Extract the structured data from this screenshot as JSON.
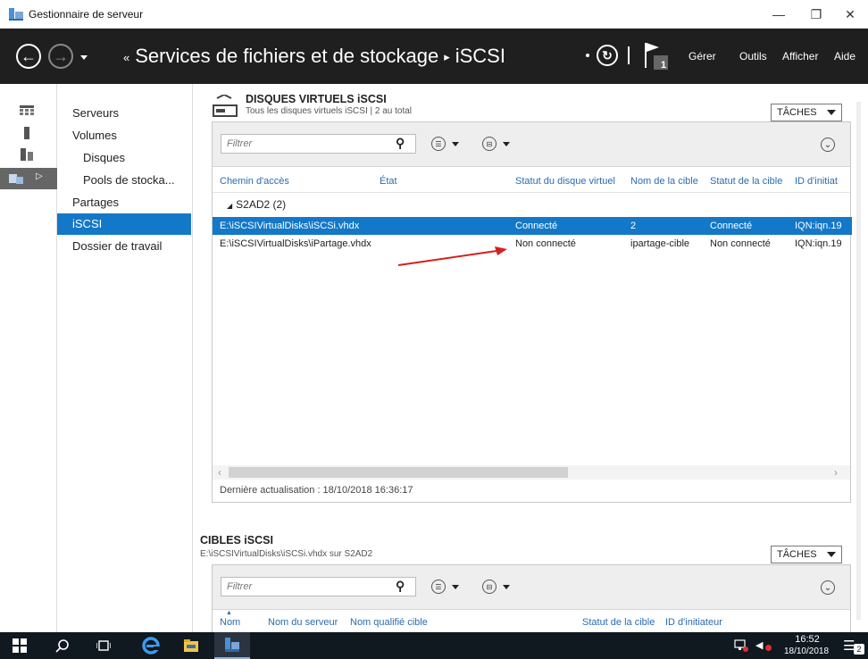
{
  "window": {
    "title": "Gestionnaire de serveur",
    "controls": [
      "—",
      "❐",
      "✕"
    ]
  },
  "header": {
    "breadcrumb_root": "Services de fichiers et de stockage",
    "breadcrumb_current": "iSCSI",
    "crumb_prefix": "«",
    "crumb_sep": "▸",
    "notification_count": "1",
    "menu": [
      "Gérer",
      "Outils",
      "Afficher",
      "Aide"
    ]
  },
  "rail": {
    "icons": [
      "dashboard-icon",
      "local-server-icon",
      "all-servers-icon",
      "file-services-icon"
    ],
    "expander": "▷"
  },
  "nav": {
    "items": [
      {
        "label": "Serveurs",
        "sub": false,
        "active": false
      },
      {
        "label": "Volumes",
        "sub": false,
        "active": false
      },
      {
        "label": "Disques",
        "sub": true,
        "active": false
      },
      {
        "label": "Pools de stocka...",
        "sub": true,
        "active": false
      },
      {
        "label": "Partages",
        "sub": false,
        "active": false
      },
      {
        "label": "iSCSI",
        "sub": false,
        "active": true
      },
      {
        "label": "Dossier de travail",
        "sub": false,
        "active": false
      }
    ]
  },
  "vdisks": {
    "title": "DISQUES VIRTUELS iSCSI",
    "subtitle": "Tous les disques virtuels iSCSI | 2 au total",
    "tasks_label": "TÂCHES",
    "filter_placeholder": "Filtrer",
    "columns": [
      "Chemin d'accès",
      "État",
      "Statut du disque virtuel",
      "Nom de la cible",
      "Statut de la cible",
      "ID d'initiat"
    ],
    "group": {
      "expander": "◢",
      "label": "S2AD2 (2)"
    },
    "rows": [
      {
        "path": "E:\\iSCSIVirtualDisks\\iSCSi.vhdx",
        "state": "",
        "disk_status": "Connecté",
        "target_name": "2",
        "target_status": "Connecté",
        "initiator": "IQN:iqn.19",
        "selected": true
      },
      {
        "path": "E:\\iSCSIVirtualDisks\\iPartage.vhdx",
        "state": "",
        "disk_status": "Non connecté",
        "target_name": "ipartage-cible",
        "target_status": "Non connecté",
        "initiator": "IQN:iqn.19",
        "selected": false
      }
    ],
    "last_update": "Dernière actualisation : 18/10/2018 16:36:17",
    "scroll_left": "‹",
    "scroll_right": "›"
  },
  "targets": {
    "title": "CIBLES iSCSI",
    "subtitle": "E:\\iSCSIVirtualDisks\\iSCSi.vhdx sur S2AD2",
    "tasks_label": "TÂCHES",
    "filter_placeholder": "Filtrer",
    "columns": [
      "Nom",
      "Nom du serveur",
      "Nom qualifié cible",
      "Statut de la cible",
      "ID d'initiateur"
    ]
  },
  "glyphs": {
    "back": "←",
    "forward": "→",
    "refresh": "↻",
    "search": "⚲",
    "list": "☰",
    "save": "⊟",
    "expand": "⌄",
    "sort_up": "▲",
    "speaker": "◀",
    "notification": "☰"
  },
  "taskbar": {
    "time": "16:52",
    "date": "18/10/2018",
    "notif_count": "2"
  },
  "colors": {
    "accent": "#1478c8",
    "header_bg": "#1f1f1f",
    "taskbar_bg": "#101820",
    "annotation_arrow": "#d42020"
  }
}
